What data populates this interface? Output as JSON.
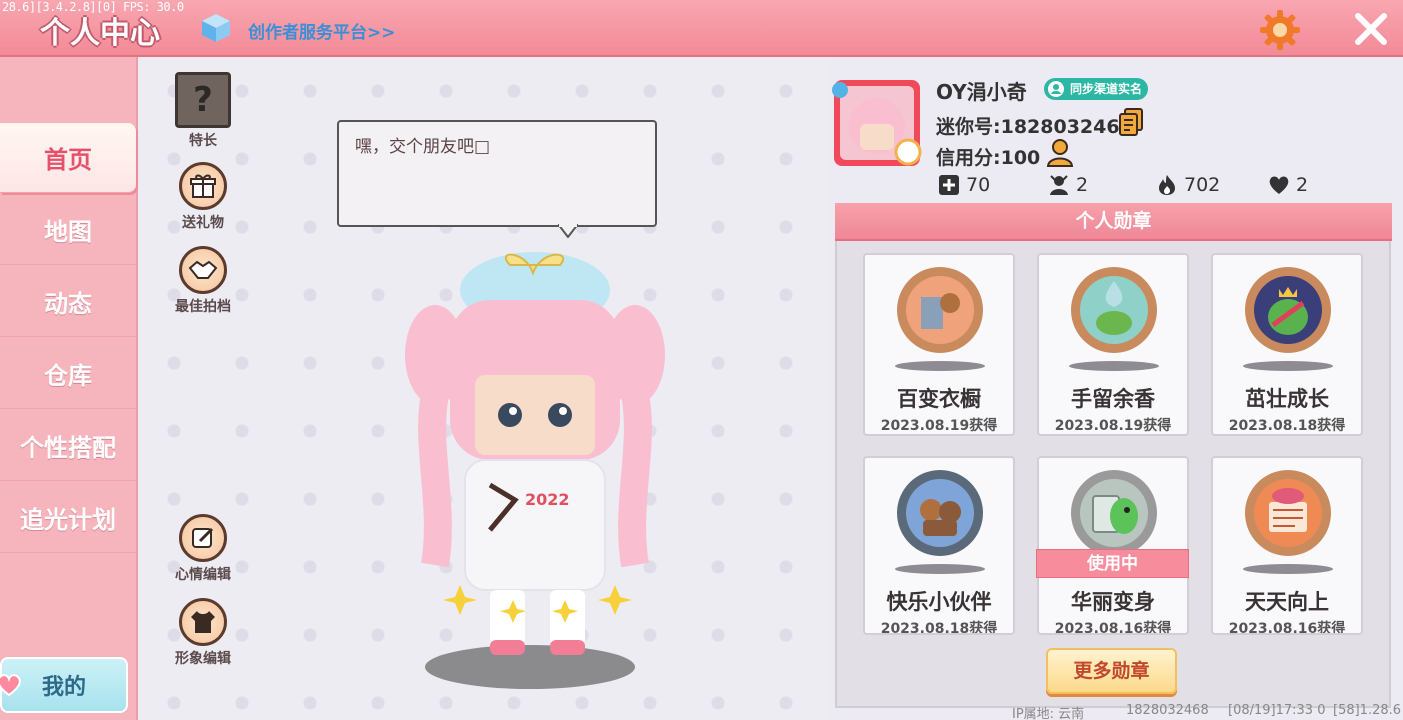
{
  "debug": "28.6][3.4.2.8][0] FPS: 30.0",
  "header": {
    "title": "个人中心",
    "creator_link": "创作者服务平台>>"
  },
  "nav": {
    "items": [
      "首页",
      "地图",
      "动态",
      "仓库",
      "个性搭配",
      "追光计划"
    ],
    "active_index": 0,
    "mine_label": "我的"
  },
  "side_buttons": {
    "talent": "特长",
    "gift": "送礼物",
    "partner": "最佳拍档",
    "mood_edit": "心情编辑",
    "image_edit": "形象编辑",
    "talent_glyph": "?"
  },
  "speech_bubble": "嘿，交个朋友吧□",
  "avatar_badge": "2022",
  "profile": {
    "name": "OY涓小奇",
    "verify_label": "同步渠道实名",
    "mini_number": "迷你号:1828032468",
    "credit": "信用分:100",
    "stats": [
      {
        "icon": "add-friend-icon",
        "value": "70"
      },
      {
        "icon": "fans-icon",
        "value": "2"
      },
      {
        "icon": "fire-icon",
        "value": "702"
      },
      {
        "icon": "heart-icon",
        "value": "2"
      }
    ]
  },
  "medals": {
    "header": "个人勋章",
    "items": [
      {
        "name": "百变衣橱",
        "date": "2023.08.19获得",
        "ring": "#c98a5e",
        "inner": "#f0a37b"
      },
      {
        "name": "手留余香",
        "date": "2023.08.19获得",
        "ring": "#c98a5e",
        "inner": "#8fd0c8"
      },
      {
        "name": "茁壮成长",
        "date": "2023.08.18获得",
        "ring": "#c98a5e",
        "inner": "#3a3f7a"
      },
      {
        "name": "快乐小伙伴",
        "date": "2023.08.18获得",
        "ring": "#5a6a7a",
        "inner": "#7fa5d8"
      },
      {
        "name": "华丽变身",
        "date": "2023.08.16获得",
        "ring": "#9a9a9a",
        "inner": "#b9c6c0"
      },
      {
        "name": "天天向上",
        "date": "2023.08.16获得",
        "ring": "#c98a5e",
        "inner": "#f08a55"
      }
    ],
    "in_use_label": "使用中",
    "more_label": "更多勋章"
  },
  "footer": {
    "ip_location": "IP属地: 云南",
    "uid": "1828032468",
    "time": "[08/19]17:33 0",
    "version": "[58]1.28.6"
  },
  "colors": {
    "header_pink": "#f38a97",
    "nav_pink": "#f6b4bc",
    "active_text": "#e5506a",
    "teal_badge": "#2bb7a4",
    "more_button_text": "#c2482b"
  }
}
